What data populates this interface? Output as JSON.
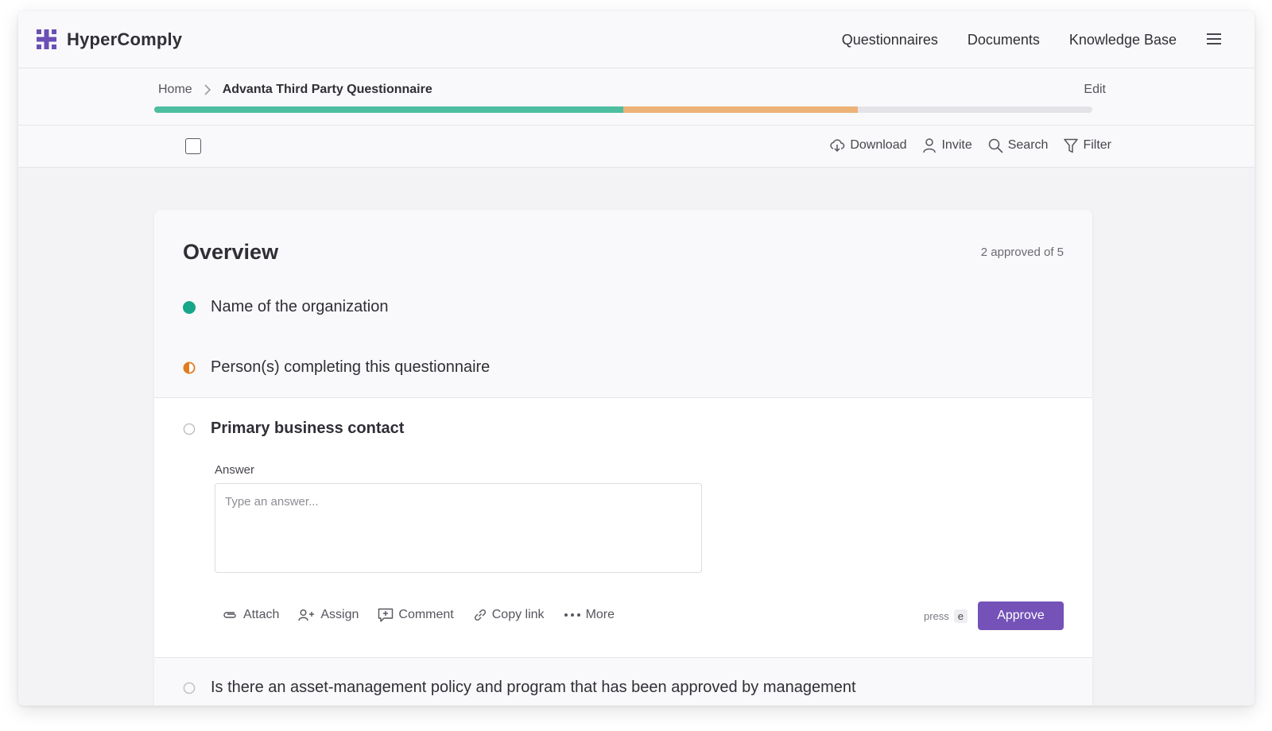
{
  "brand": {
    "name": "HyperComply",
    "icon": "hypercomply-logo-icon"
  },
  "nav": {
    "items": [
      "Questionnaires",
      "Documents",
      "Knowledge Base"
    ],
    "menu_icon": "hamburger-menu-icon"
  },
  "breadcrumb": {
    "home": "Home",
    "current": "Advanta Third Party Questionnaire"
  },
  "edit_label": "Edit",
  "progress": {
    "approved": 0.5,
    "in_progress": 0.25,
    "colors": {
      "approved": "#4dbea0",
      "in_progress": "#ecb277",
      "track": "#e4e4e8"
    }
  },
  "toolbar": {
    "download": "Download",
    "invite": "Invite",
    "search": "Search",
    "filter": "Filter"
  },
  "section": {
    "title": "Overview",
    "status": "2 approved of 5"
  },
  "questions": [
    {
      "text": "Name of the organization",
      "status": "approved",
      "color": "#17a689"
    },
    {
      "text": "Person(s) completing this questionnaire",
      "status": "in-progress",
      "color": "#e07b1f"
    },
    {
      "text": "Primary business contact",
      "status": "empty",
      "color": "#bdbdc4"
    },
    {
      "text": "Is there an asset-management policy and program that has been approved by management",
      "status": "empty",
      "color": "#bdbdc4"
    }
  ],
  "answer": {
    "label": "Answer",
    "placeholder": "Type an answer...",
    "value": ""
  },
  "actions": {
    "attach": "Attach",
    "assign": "Assign",
    "comment": "Comment",
    "copy_link": "Copy link",
    "more": "More"
  },
  "approve": {
    "hint_prefix": "press",
    "hint_key": "e",
    "label": "Approve",
    "color": "#7452b8"
  }
}
